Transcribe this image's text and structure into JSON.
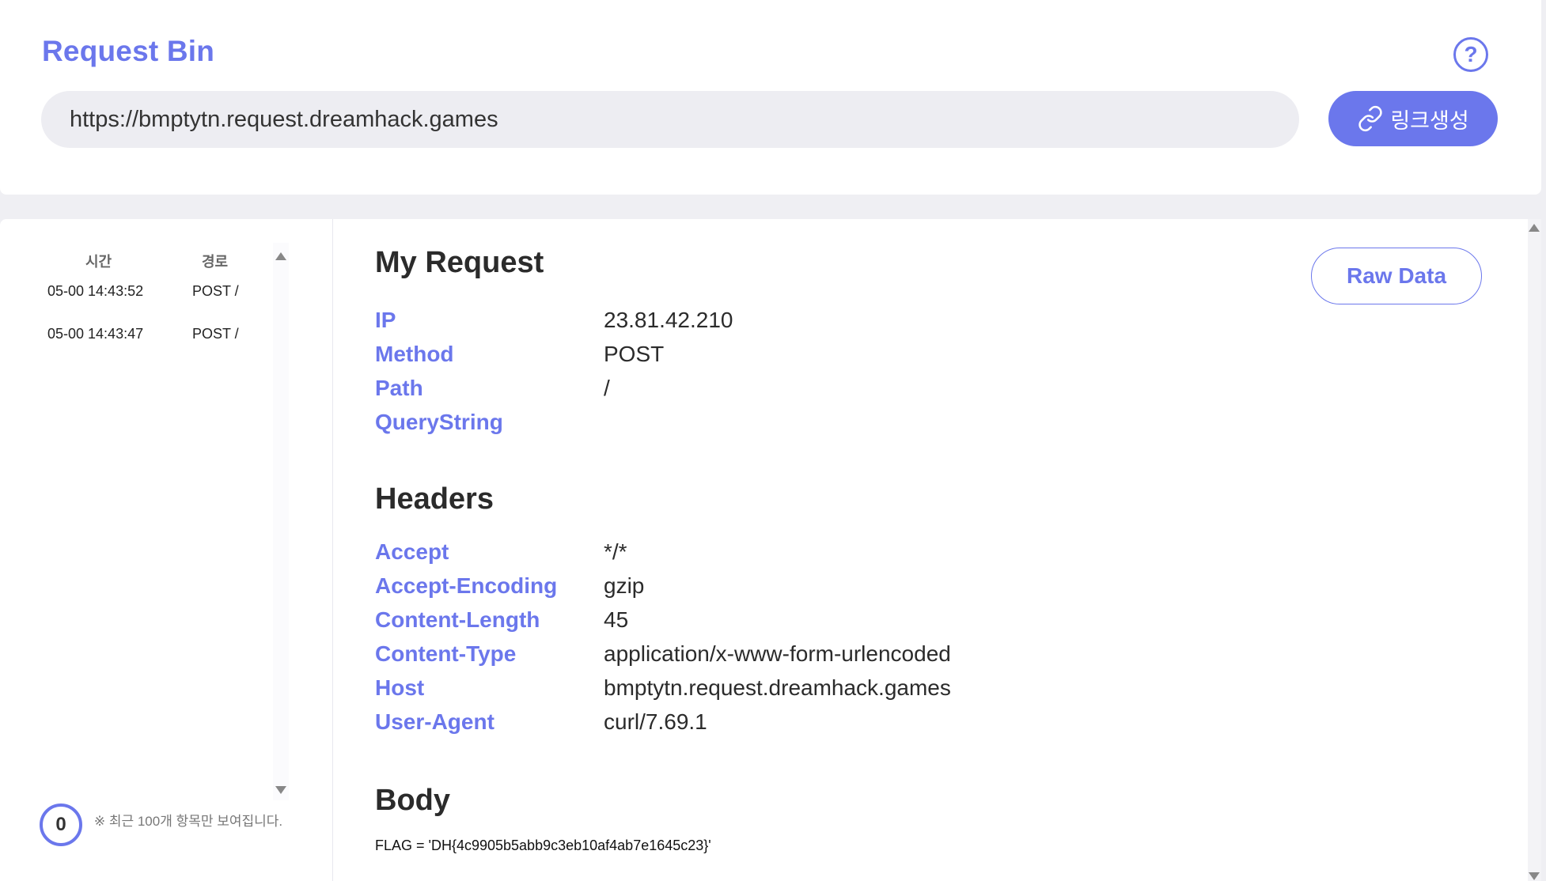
{
  "header": {
    "title": "Request Bin",
    "help_symbol": "?",
    "url_value": "https://bmptytn.request.dreamhack.games",
    "link_button_label": "링크생성"
  },
  "sidebar": {
    "col_time": "시간",
    "col_path": "경로",
    "rows": [
      {
        "time": "05-00 14:43:52",
        "path": "POST /"
      },
      {
        "time": "05-00 14:43:47",
        "path": "POST /"
      }
    ],
    "count": "0",
    "note": "※ 최근 100개 항목만 보여집니다."
  },
  "detail": {
    "raw_button_label": "Raw Data",
    "request_title": "My Request",
    "request_fields": [
      {
        "key": "IP",
        "value": "23.81.42.210"
      },
      {
        "key": "Method",
        "value": "POST"
      },
      {
        "key": "Path",
        "value": "/"
      },
      {
        "key": "QueryString",
        "value": ""
      }
    ],
    "headers_title": "Headers",
    "headers": [
      {
        "key": "Accept",
        "value": "*/*"
      },
      {
        "key": "Accept-Encoding",
        "value": "gzip"
      },
      {
        "key": "Content-Length",
        "value": "45"
      },
      {
        "key": "Content-Type",
        "value": "application/x-www-form-urlencoded"
      },
      {
        "key": "Host",
        "value": "bmptytn.request.dreamhack.games"
      },
      {
        "key": "User-Agent",
        "value": "curl/7.69.1"
      }
    ],
    "body_title": "Body",
    "body_text": "FLAG = 'DH{4c9905b5abb9c3eb10af4ab7e1645c23}'"
  },
  "colors": {
    "accent": "#6b77ec",
    "page_bg": "#efeff3",
    "input_bg": "#ededf2"
  },
  "icons": {
    "help": "question-circle-icon",
    "link": "link-icon",
    "scroll_up": "triangle-up-icon",
    "scroll_down": "triangle-down-icon"
  }
}
